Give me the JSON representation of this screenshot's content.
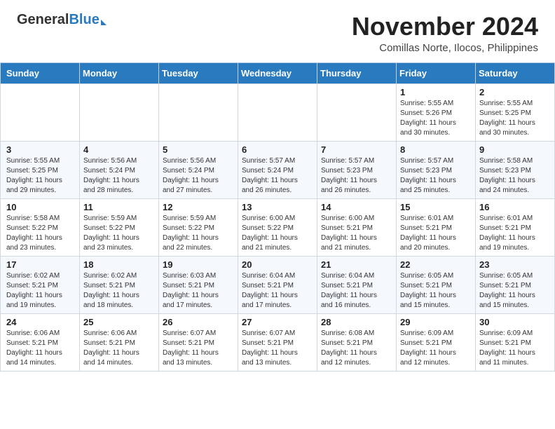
{
  "header": {
    "logo_general": "General",
    "logo_blue": "Blue",
    "month_year": "November 2024",
    "location": "Comillas Norte, Ilocos, Philippines"
  },
  "days_of_week": [
    "Sunday",
    "Monday",
    "Tuesday",
    "Wednesday",
    "Thursday",
    "Friday",
    "Saturday"
  ],
  "weeks": [
    [
      {
        "day": "",
        "detail": ""
      },
      {
        "day": "",
        "detail": ""
      },
      {
        "day": "",
        "detail": ""
      },
      {
        "day": "",
        "detail": ""
      },
      {
        "day": "",
        "detail": ""
      },
      {
        "day": "1",
        "detail": "Sunrise: 5:55 AM\nSunset: 5:26 PM\nDaylight: 11 hours\nand 30 minutes."
      },
      {
        "day": "2",
        "detail": "Sunrise: 5:55 AM\nSunset: 5:25 PM\nDaylight: 11 hours\nand 30 minutes."
      }
    ],
    [
      {
        "day": "3",
        "detail": "Sunrise: 5:55 AM\nSunset: 5:25 PM\nDaylight: 11 hours\nand 29 minutes."
      },
      {
        "day": "4",
        "detail": "Sunrise: 5:56 AM\nSunset: 5:24 PM\nDaylight: 11 hours\nand 28 minutes."
      },
      {
        "day": "5",
        "detail": "Sunrise: 5:56 AM\nSunset: 5:24 PM\nDaylight: 11 hours\nand 27 minutes."
      },
      {
        "day": "6",
        "detail": "Sunrise: 5:57 AM\nSunset: 5:24 PM\nDaylight: 11 hours\nand 26 minutes."
      },
      {
        "day": "7",
        "detail": "Sunrise: 5:57 AM\nSunset: 5:23 PM\nDaylight: 11 hours\nand 26 minutes."
      },
      {
        "day": "8",
        "detail": "Sunrise: 5:57 AM\nSunset: 5:23 PM\nDaylight: 11 hours\nand 25 minutes."
      },
      {
        "day": "9",
        "detail": "Sunrise: 5:58 AM\nSunset: 5:23 PM\nDaylight: 11 hours\nand 24 minutes."
      }
    ],
    [
      {
        "day": "10",
        "detail": "Sunrise: 5:58 AM\nSunset: 5:22 PM\nDaylight: 11 hours\nand 23 minutes."
      },
      {
        "day": "11",
        "detail": "Sunrise: 5:59 AM\nSunset: 5:22 PM\nDaylight: 11 hours\nand 23 minutes."
      },
      {
        "day": "12",
        "detail": "Sunrise: 5:59 AM\nSunset: 5:22 PM\nDaylight: 11 hours\nand 22 minutes."
      },
      {
        "day": "13",
        "detail": "Sunrise: 6:00 AM\nSunset: 5:22 PM\nDaylight: 11 hours\nand 21 minutes."
      },
      {
        "day": "14",
        "detail": "Sunrise: 6:00 AM\nSunset: 5:21 PM\nDaylight: 11 hours\nand 21 minutes."
      },
      {
        "day": "15",
        "detail": "Sunrise: 6:01 AM\nSunset: 5:21 PM\nDaylight: 11 hours\nand 20 minutes."
      },
      {
        "day": "16",
        "detail": "Sunrise: 6:01 AM\nSunset: 5:21 PM\nDaylight: 11 hours\nand 19 minutes."
      }
    ],
    [
      {
        "day": "17",
        "detail": "Sunrise: 6:02 AM\nSunset: 5:21 PM\nDaylight: 11 hours\nand 19 minutes."
      },
      {
        "day": "18",
        "detail": "Sunrise: 6:02 AM\nSunset: 5:21 PM\nDaylight: 11 hours\nand 18 minutes."
      },
      {
        "day": "19",
        "detail": "Sunrise: 6:03 AM\nSunset: 5:21 PM\nDaylight: 11 hours\nand 17 minutes."
      },
      {
        "day": "20",
        "detail": "Sunrise: 6:04 AM\nSunset: 5:21 PM\nDaylight: 11 hours\nand 17 minutes."
      },
      {
        "day": "21",
        "detail": "Sunrise: 6:04 AM\nSunset: 5:21 PM\nDaylight: 11 hours\nand 16 minutes."
      },
      {
        "day": "22",
        "detail": "Sunrise: 6:05 AM\nSunset: 5:21 PM\nDaylight: 11 hours\nand 15 minutes."
      },
      {
        "day": "23",
        "detail": "Sunrise: 6:05 AM\nSunset: 5:21 PM\nDaylight: 11 hours\nand 15 minutes."
      }
    ],
    [
      {
        "day": "24",
        "detail": "Sunrise: 6:06 AM\nSunset: 5:21 PM\nDaylight: 11 hours\nand 14 minutes."
      },
      {
        "day": "25",
        "detail": "Sunrise: 6:06 AM\nSunset: 5:21 PM\nDaylight: 11 hours\nand 14 minutes."
      },
      {
        "day": "26",
        "detail": "Sunrise: 6:07 AM\nSunset: 5:21 PM\nDaylight: 11 hours\nand 13 minutes."
      },
      {
        "day": "27",
        "detail": "Sunrise: 6:07 AM\nSunset: 5:21 PM\nDaylight: 11 hours\nand 13 minutes."
      },
      {
        "day": "28",
        "detail": "Sunrise: 6:08 AM\nSunset: 5:21 PM\nDaylight: 11 hours\nand 12 minutes."
      },
      {
        "day": "29",
        "detail": "Sunrise: 6:09 AM\nSunset: 5:21 PM\nDaylight: 11 hours\nand 12 minutes."
      },
      {
        "day": "30",
        "detail": "Sunrise: 6:09 AM\nSunset: 5:21 PM\nDaylight: 11 hours\nand 11 minutes."
      }
    ]
  ]
}
